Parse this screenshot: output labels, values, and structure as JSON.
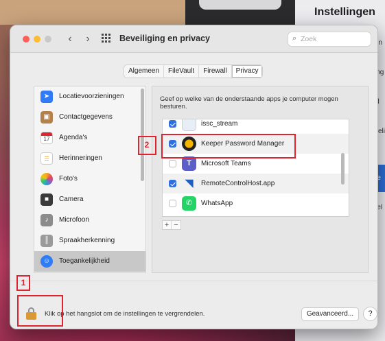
{
  "window": {
    "title": "Beveiliging en privacy",
    "search_placeholder": "Zoek"
  },
  "tabs": [
    {
      "label": "Algemeen",
      "active": false
    },
    {
      "label": "FileVault",
      "active": false
    },
    {
      "label": "Firewall",
      "active": false
    },
    {
      "label": "Privacy",
      "active": true
    }
  ],
  "sidebar": {
    "items": [
      {
        "label": "Locatievoorzieningen",
        "icon": "location-arrow-icon",
        "color": "#2f7cf6"
      },
      {
        "label": "Contactgegevens",
        "icon": "contacts-icon",
        "color": "#b5814a"
      },
      {
        "label": "Agenda's",
        "icon": "calendar-icon",
        "color": "#ffffff",
        "badge": "17"
      },
      {
        "label": "Herinneringen",
        "icon": "reminders-icon",
        "color": "#ffffff"
      },
      {
        "label": "Foto's",
        "icon": "photos-icon",
        "color": "#f5a623"
      },
      {
        "label": "Camera",
        "icon": "camera-icon",
        "color": "#3a3a3a"
      },
      {
        "label": "Microfoon",
        "icon": "microphone-icon",
        "color": "#8c8c8c"
      },
      {
        "label": "Spraakherkenning",
        "icon": "speech-recognition-icon",
        "color": "#9a9a9a"
      },
      {
        "label": "Toegankelijkheid",
        "icon": "accessibility-icon",
        "color": "#2f7cf6",
        "selected": true
      }
    ]
  },
  "pane": {
    "description": "Geef op welke van de onderstaande apps je computer mogen besturen.",
    "apps": [
      {
        "label": "issc_stream",
        "checked": true,
        "icon": "generic-app-icon"
      },
      {
        "label": "Keeper Password Manager",
        "checked": true,
        "icon": "keeper-icon"
      },
      {
        "label": "Microsoft Teams",
        "checked": false,
        "icon": "teams-icon"
      },
      {
        "label": "RemoteControlHost.app",
        "checked": true,
        "icon": "remote-control-icon"
      },
      {
        "label": "WhatsApp",
        "checked": false,
        "icon": "whatsapp-icon"
      }
    ],
    "add_label": "+",
    "remove_label": "−"
  },
  "bottom": {
    "lock_text": "Klik op het hangslot om de instellingen te vergrendelen.",
    "advanced_label": "Geavanceerd...",
    "help_label": "?"
  },
  "callouts": [
    {
      "number": "1"
    },
    {
      "number": "2"
    }
  ],
  "background_window": {
    "title": "Instellingen",
    "snippets": [
      "en",
      "ing",
      "ill",
      "keli",
      "re",
      "rel"
    ]
  }
}
